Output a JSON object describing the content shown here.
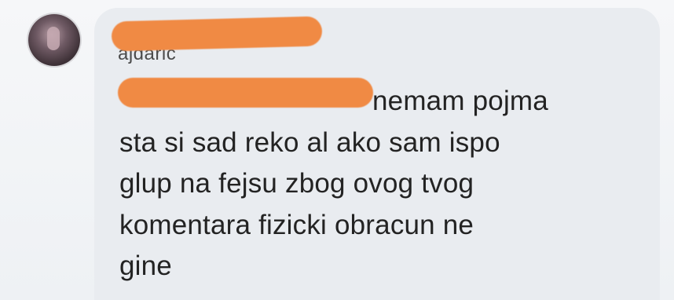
{
  "comment": {
    "author_name_fragment": "ajdaric",
    "lines": [
      "nemam pojma",
      "sta si sad reko al ako sam ispo",
      "glup na fejsu zbog ovog tvog",
      "komentara fizicki obracun ne",
      "gine"
    ]
  },
  "colors": {
    "redaction": "#f08a44",
    "bubble_background": "#e9ecf0",
    "text": "#232323"
  },
  "icons": {
    "avatar": "profile-avatar-photo"
  }
}
